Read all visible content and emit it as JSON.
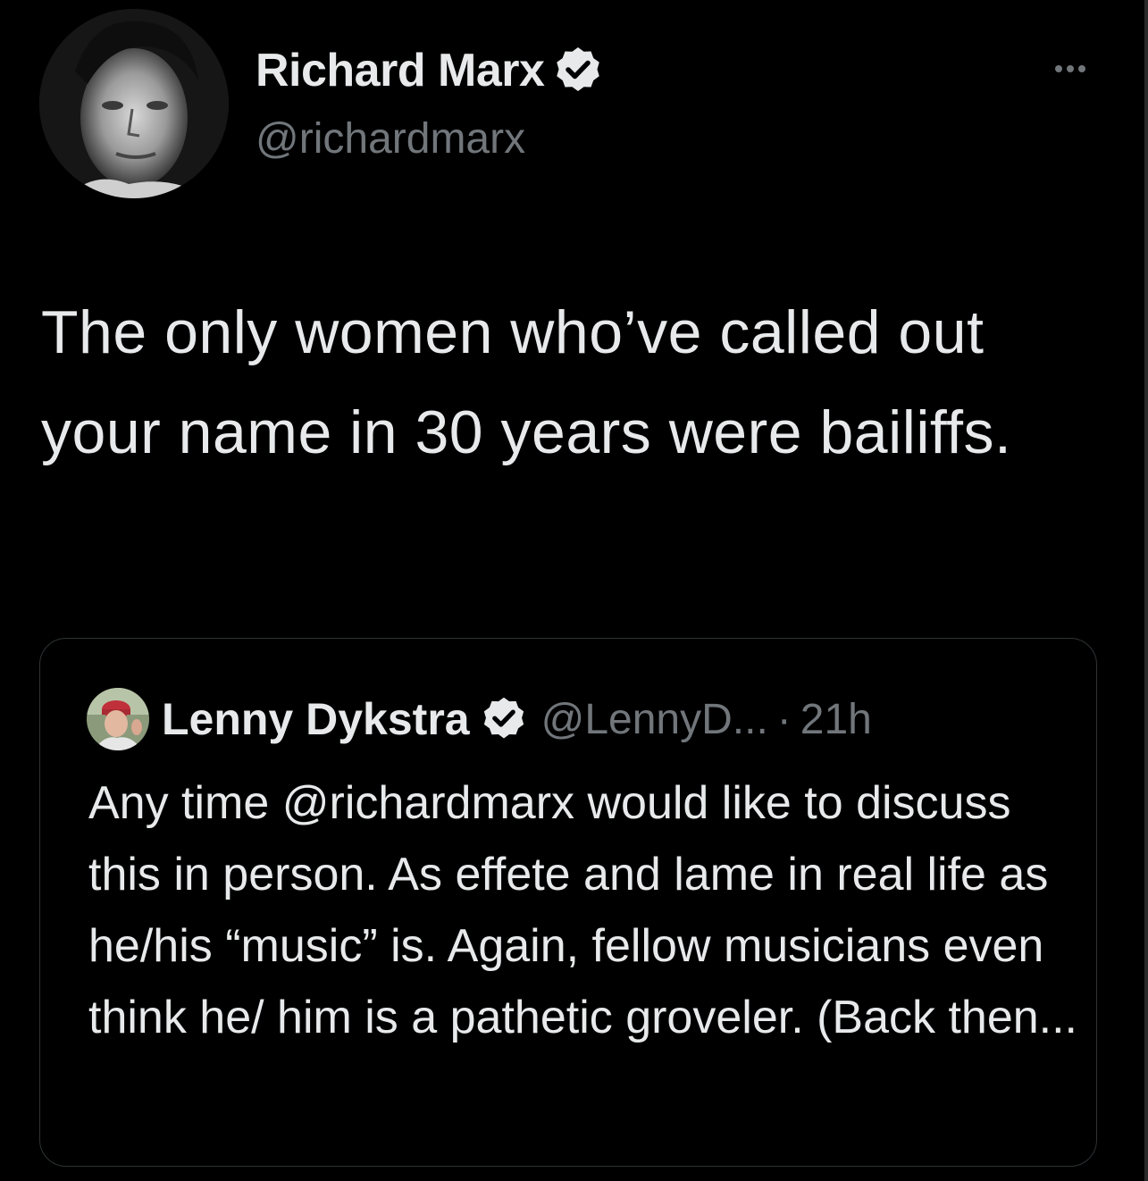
{
  "tweet": {
    "author": {
      "name": "Richard Marx",
      "handle": "@richardmarx",
      "verified": true
    },
    "more_icon": "more-horizontal-icon",
    "text": "The only women who’ve called out your name in 30 years were bailiffs."
  },
  "quoted_tweet": {
    "author": {
      "name": "Lenny Dykstra",
      "handle": "@LennyD...",
      "verified": true
    },
    "separator": "·",
    "time": "21h",
    "text": "Any time @richardmarx would like to discuss this in person. As effete and lame in real life as he/his “music” is. Again, fellow musicians even think he/ him is a pathetic groveler. (Back then..."
  },
  "colors": {
    "background": "#000000",
    "primary_text": "#e7e9ea",
    "secondary_text": "#71767b",
    "border": "#2f3336",
    "verified_badge_fill": "#e7e9ea",
    "verified_check": "#000000"
  }
}
